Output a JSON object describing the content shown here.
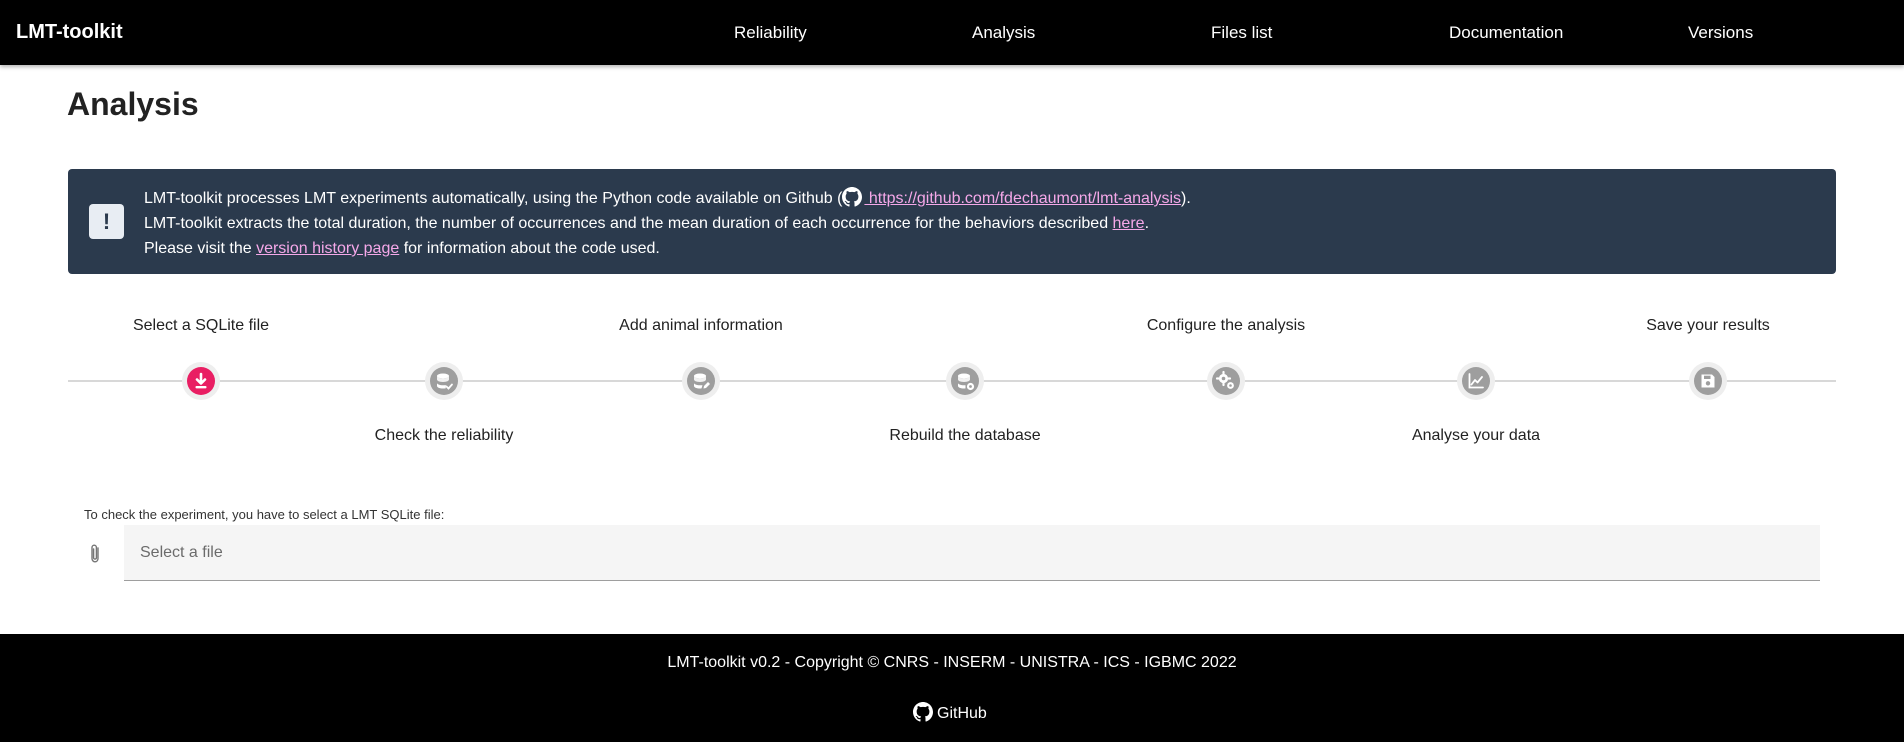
{
  "navbar": {
    "brand": "LMT-toolkit",
    "items": [
      "Reliability",
      "Analysis",
      "Files list",
      "Documentation",
      "Versions"
    ]
  },
  "page": {
    "title": "Analysis"
  },
  "alert": {
    "icon": "exclamation-icon",
    "line1_prefix": "LMT-toolkit processes LMT experiments automatically, using the Python code available on Github (",
    "line1_link": " https://github.com/fdechaumont/lmt-analysis",
    "line1_suffix": ").",
    "line2_prefix": "LMT-toolkit extracts the total duration, the number of occurrences and the mean duration of each occurrence for the behaviors described ",
    "line2_link": "here",
    "line2_suffix": ".",
    "line3_prefix": "Please visit the ",
    "line3_link": "version history page",
    "line3_suffix": " for information about the code used."
  },
  "stepper": {
    "steps": [
      {
        "label": "Select a SQLite file",
        "icon": "download-icon",
        "active": true
      },
      {
        "label": "Check the reliability",
        "icon": "database-check-icon",
        "active": false
      },
      {
        "label": "Add animal information",
        "icon": "database-edit-icon",
        "active": false
      },
      {
        "label": "Rebuild the database",
        "icon": "database-cog-icon",
        "active": false
      },
      {
        "label": "Configure the analysis",
        "icon": "cogs-icon",
        "active": false
      },
      {
        "label": "Analyse your data",
        "icon": "chart-line-icon",
        "active": false
      },
      {
        "label": "Save your results",
        "icon": "save-icon",
        "active": false
      }
    ]
  },
  "file_input": {
    "label": "To check the experiment, you have to select a LMT SQLite file:",
    "placeholder": "Select a file",
    "icon": "paperclip-icon"
  },
  "footer": {
    "copyright": "LMT-toolkit v0.2 - Copyright © CNRS - INSERM - UNISTRA - ICS - IGBMC 2022",
    "github": "GitHub"
  },
  "colors": {
    "navbar": "#000000",
    "alert_bg": "#2b3a4d",
    "link": "#f5a8e9",
    "active_step": "#e91e63",
    "inactive_step": "#9e9e9e"
  }
}
